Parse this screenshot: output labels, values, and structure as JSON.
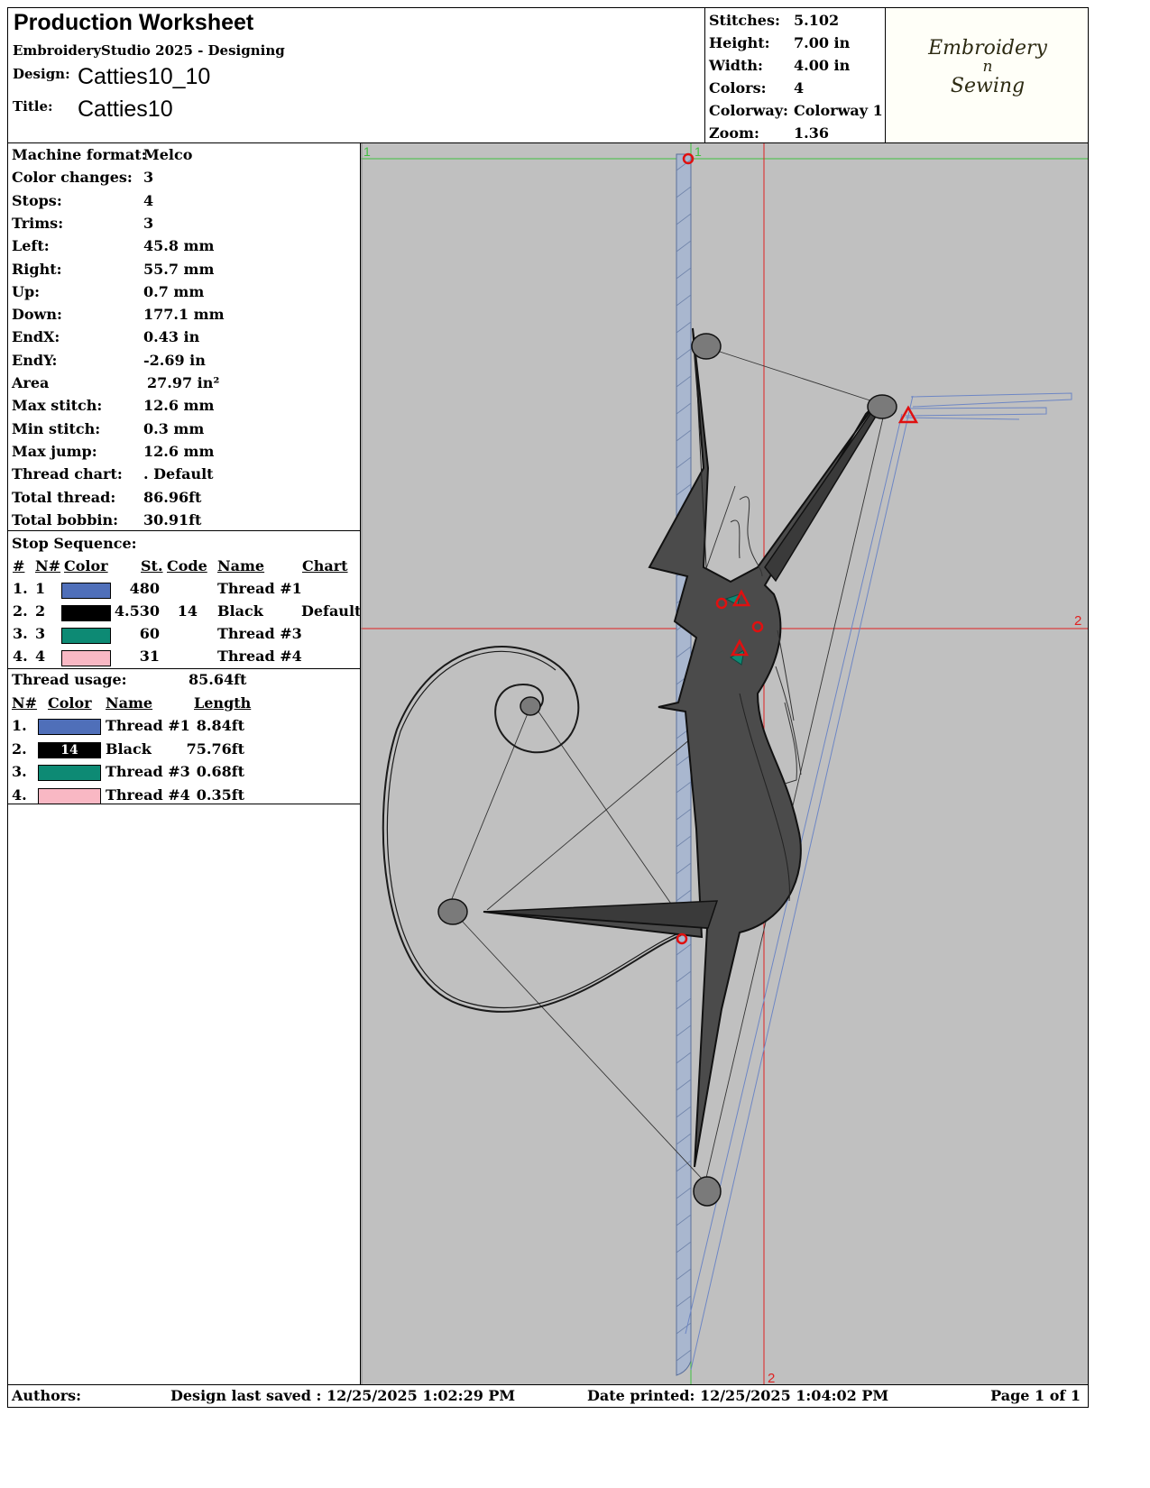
{
  "header": {
    "title": "Production Worksheet",
    "software": "EmbroideryStudio 2025 - Designing",
    "design_label": "Design:",
    "design_value": "Catties10_10",
    "title_label": "Title:",
    "title_value": "Catties10"
  },
  "summary": [
    {
      "label": "Stitches:",
      "value": "5.102"
    },
    {
      "label": "Height:",
      "value": "7.00 in"
    },
    {
      "label": "Width:",
      "value": "4.00 in"
    },
    {
      "label": "Colors:",
      "value": "4"
    },
    {
      "label": "Colorway:",
      "value": "Colorway 1"
    },
    {
      "label": "Zoom:",
      "value": "1.36"
    }
  ],
  "logo": {
    "line1": "Embroidery",
    "line2": "n",
    "line3": "Sewing"
  },
  "details": [
    {
      "label": "Machine format:",
      "value": "Melco"
    },
    {
      "label": "Color changes:",
      "value": "3"
    },
    {
      "label": "Stops:",
      "value": "4"
    },
    {
      "label": "Trims:",
      "value": "3"
    },
    {
      "label": "Left:",
      "value": "45.8 mm"
    },
    {
      "label": "Right:",
      "value": "55.7 mm"
    },
    {
      "label": "Up:",
      "value": "0.7 mm"
    },
    {
      "label": "Down:",
      "value": "177.1 mm"
    },
    {
      "label": "EndX:",
      "value": "0.43 in"
    },
    {
      "label": "EndY:",
      "value": "-2.69 in"
    },
    {
      "label": "Area",
      "value": "27.97 in²"
    },
    {
      "label": "Max stitch:",
      "value": "12.6 mm"
    },
    {
      "label": "Min stitch:",
      "value": "0.3 mm"
    },
    {
      "label": "Max jump:",
      "value": "12.6 mm"
    },
    {
      "label": "Thread chart:",
      "value": ". Default"
    },
    {
      "label": "Total thread:",
      "value": "86.96ft"
    },
    {
      "label": "Total bobbin:",
      "value": "30.91ft"
    }
  ],
  "stop_sequence": {
    "title": "Stop Sequence:",
    "headers": {
      "num": "#",
      "n": "N#",
      "color": "Color",
      "st": "St.",
      "code": "Code",
      "name": "Name",
      "chart": "Chart"
    },
    "rows": [
      {
        "num": "1.",
        "n": "1",
        "color": "#4f6fb9",
        "st": "480",
        "code": "",
        "name": "Thread #1",
        "chart": ""
      },
      {
        "num": "2.",
        "n": "2",
        "color": "#000000",
        "st": "4.530",
        "code": "14",
        "name": "Black",
        "chart": "Default"
      },
      {
        "num": "3.",
        "n": "3",
        "color": "#0d8a74",
        "st": "60",
        "code": "",
        "name": "Thread #3",
        "chart": ""
      },
      {
        "num": "4.",
        "n": "4",
        "color": "#f9b8c4",
        "st": "31",
        "code": "",
        "name": "Thread #4",
        "chart": ""
      }
    ]
  },
  "thread_usage": {
    "title": "Thread usage:",
    "total": "85.64ft",
    "headers": {
      "n": "N#",
      "color": "Color",
      "name": "Name",
      "length": "Length"
    },
    "rows": [
      {
        "n": "1.",
        "color": "#4f6fb9",
        "code": "",
        "name": "Thread #1",
        "length": "8.84ft"
      },
      {
        "n": "2.",
        "color": "#000000",
        "code": "14",
        "name": "Black",
        "length": "75.76ft"
      },
      {
        "n": "3.",
        "color": "#0d8a74",
        "code": "",
        "name": "Thread #3",
        "length": "0.68ft"
      },
      {
        "n": "4.",
        "color": "#f9b8c4",
        "code": "",
        "name": "Thread #4",
        "length": "0.35ft"
      }
    ]
  },
  "preview": {
    "marker_1_top": "1",
    "marker_1_top_b": "1",
    "marker_2_right": "2",
    "marker_2_bottom": "2",
    "background": "#c0c0c0"
  },
  "footer": {
    "authors_label": "Authors:",
    "last_saved": "Design last saved : 12/25/2025 1:02:29 PM",
    "date_printed": "Date printed: 12/25/2025 1:04:02 PM",
    "page": "Page 1 of 1"
  }
}
